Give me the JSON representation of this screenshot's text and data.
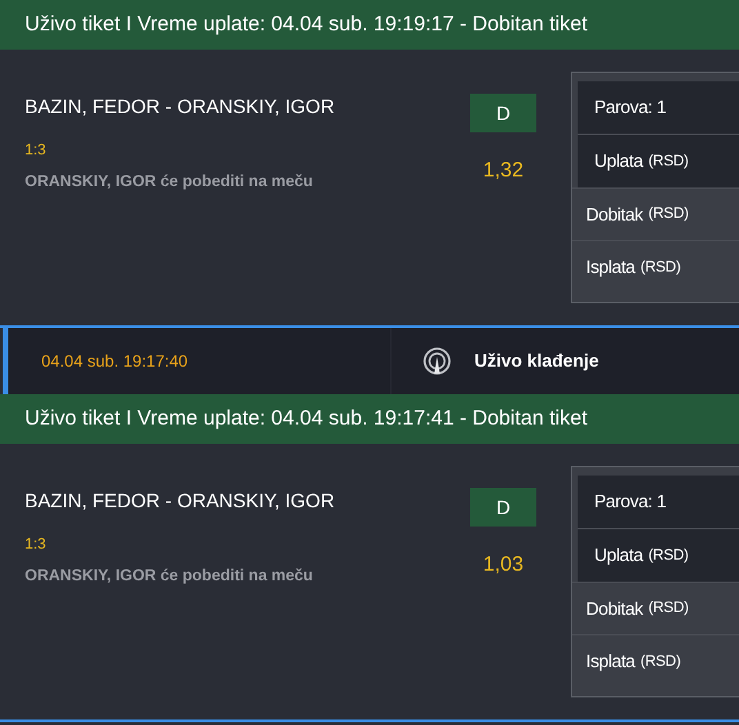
{
  "items": [
    {
      "kind": "ticket",
      "header": "Uživo tiket I Vreme uplate: 04.04 sub. 19:19:17 - Dobitan tiket",
      "match": "BAZIN, FEDOR - ORANSKIY, IGOR",
      "score": "1:3",
      "pick": "ORANSKIY, IGOR će pobediti na meču",
      "pick_label": "D",
      "odds": "1,32",
      "summary": [
        {
          "kind": "stake",
          "label": "Parova: 1"
        },
        {
          "kind": "stake",
          "label": "Uplata",
          "unit": "(RSD)"
        },
        {
          "kind": "result",
          "label": "Dobitak",
          "unit": "(RSD)"
        },
        {
          "kind": "result",
          "label": "Isplata",
          "unit": "(RSD)"
        }
      ]
    },
    {
      "kind": "event",
      "time": "04.04 sub. 19:17:40",
      "title": "Uživo klađenje"
    },
    {
      "kind": "ticket",
      "header": "Uživo tiket I Vreme uplate: 04.04 sub. 19:17:41 - Dobitan tiket",
      "match": "BAZIN, FEDOR - ORANSKIY, IGOR",
      "score": "1:3",
      "pick": "ORANSKIY, IGOR će pobediti na meču",
      "pick_label": "D",
      "odds": "1,03",
      "summary": [
        {
          "kind": "stake",
          "label": "Parova: 1"
        },
        {
          "kind": "stake",
          "label": "Uplata",
          "unit": "(RSD)"
        },
        {
          "kind": "result",
          "label": "Dobitak",
          "unit": "(RSD)"
        },
        {
          "kind": "result",
          "label": "Isplata",
          "unit": "(RSD)"
        }
      ]
    }
  ]
}
